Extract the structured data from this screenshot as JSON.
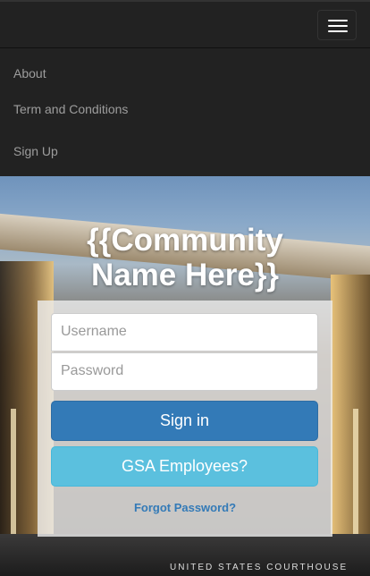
{
  "nav": {
    "items": [
      {
        "label": "About"
      },
      {
        "label": "Term and Conditions"
      },
      {
        "label": "Sign Up"
      }
    ]
  },
  "hero": {
    "title_line1": "{{Community",
    "title_line2": "Name Here}}",
    "sign_text": "UNITED STATES COURTHOUSE"
  },
  "login": {
    "username_placeholder": "Username",
    "password_placeholder": "Password",
    "signin_label": "Sign in",
    "gsa_label": "GSA Employees?",
    "forgot_label": "Forgot Password?"
  },
  "colors": {
    "navbar": "#222222",
    "primary": "#337ab7",
    "info": "#5bc0de"
  }
}
